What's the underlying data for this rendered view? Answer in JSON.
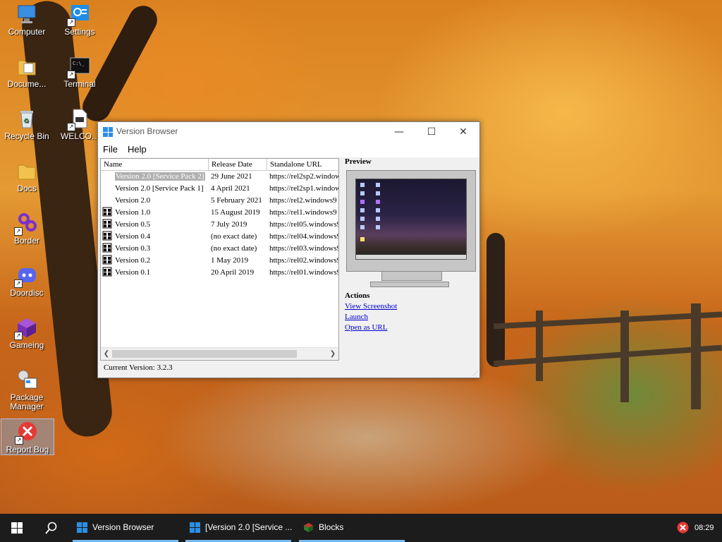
{
  "desktop": {
    "icons": [
      {
        "label": "Computer"
      },
      {
        "label": "Settings"
      },
      {
        "label": "Docume..."
      },
      {
        "label": "Terminal"
      },
      {
        "label": "Recycle Bin"
      },
      {
        "label": "WELCO..."
      },
      {
        "label": "Docs"
      },
      {
        "label": "Border"
      },
      {
        "label": "Doordisc"
      },
      {
        "label": "Gameing"
      },
      {
        "label": "Package Manager"
      },
      {
        "label": "Report Bug"
      }
    ]
  },
  "window": {
    "title": "Version Browser",
    "controls": {
      "minimize": "—",
      "maximize": "☐",
      "close": "✕"
    },
    "menu": [
      "File",
      "Help"
    ],
    "list": {
      "columns": [
        "Name",
        "Release Date",
        "Standalone URL"
      ],
      "rows": [
        {
          "name": "Version 2.0 [Service Pack 2]",
          "date": "29 June 2021",
          "url": "https://rel2sp2.window"
        },
        {
          "name": "Version 2.0 [Service Pack 1]",
          "date": "4 April 2021",
          "url": "https://rel2sp1.window"
        },
        {
          "name": "Version 2.0",
          "date": "5 February 2021",
          "url": "https://rel2.windows9"
        },
        {
          "name": "Version 1.0",
          "date": "15 August 2019",
          "url": "https://rel1.windows9"
        },
        {
          "name": "Version 0.5",
          "date": "7 July 2019",
          "url": "https://rel05.windows9"
        },
        {
          "name": "Version 0.4",
          "date": "(no exact date)",
          "url": "https://rel04.windows9"
        },
        {
          "name": "Version 0.3",
          "date": "(no exact date)",
          "url": "https://rel03.windows9"
        },
        {
          "name": "Version 0.2",
          "date": "1 May 2019",
          "url": "https://rel02.windows9"
        },
        {
          "name": "Version 0.1",
          "date": "20 April 2019",
          "url": "https://rel01.windows9"
        }
      ],
      "selected_index": 0
    },
    "status": "Current Version: 3.2.3",
    "preview_title": "Preview",
    "actions_title": "Actions",
    "actions": [
      "View Screenshot",
      "Launch",
      "Open as URL"
    ]
  },
  "taskbar": {
    "apps": [
      {
        "label": "Version Browser",
        "icon": "windows-logo-icon"
      },
      {
        "label": "[Version 2.0 [Service ...",
        "icon": "windows-logo-icon"
      },
      {
        "label": "Blocks",
        "icon": "cube-icon"
      }
    ],
    "clock": "08:29",
    "accent": "#76b9ed"
  }
}
